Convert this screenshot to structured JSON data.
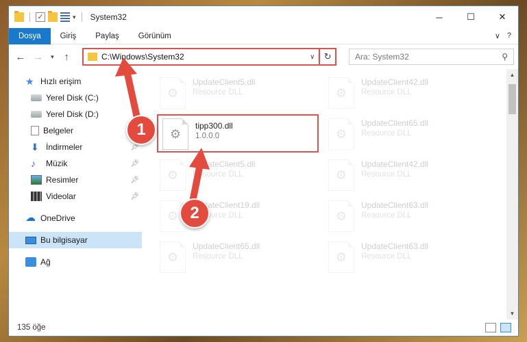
{
  "window": {
    "title": "System32",
    "controls": {
      "minimize": "─",
      "maximize": "☐",
      "close": "✕"
    }
  },
  "ribbon": {
    "tabs": [
      {
        "label": "Dosya",
        "active": true
      },
      {
        "label": "Giriş"
      },
      {
        "label": "Paylaş"
      },
      {
        "label": "Görünüm"
      }
    ],
    "expand": "∨",
    "help": "?"
  },
  "address": {
    "path": "C:\\Windows\\System32",
    "search_placeholder": "Ara: System32"
  },
  "nav": {
    "items": [
      {
        "label": "Hızlı erişim",
        "icon": "star-icon"
      },
      {
        "label": "Yerel Disk (C:)",
        "icon": "drive-icon"
      },
      {
        "label": "Yerel Disk (D:)",
        "icon": "drive-icon"
      },
      {
        "label": "Belgeler",
        "icon": "document-icon"
      },
      {
        "label": "İndirmeler",
        "icon": "download-icon",
        "pinned": true
      },
      {
        "label": "Müzik",
        "icon": "music-icon",
        "pinned": true
      },
      {
        "label": "Resimler",
        "icon": "pictures-icon",
        "pinned": true
      },
      {
        "label": "Videolar",
        "icon": "video-icon",
        "pinned": true
      },
      {
        "label": "OneDrive",
        "icon": "cloud-icon"
      },
      {
        "label": "Bu bilgisayar",
        "icon": "computer-icon",
        "selected": true
      },
      {
        "label": "Ağ",
        "icon": "network-icon"
      }
    ]
  },
  "files": {
    "highlighted": {
      "name": "tipp300.dll",
      "desc": "1.0.0.0"
    },
    "faded": [
      {
        "name": "UpdateClient5.dll",
        "desc": "Resource DLL"
      },
      {
        "name": "UpdateClient42.dll",
        "desc": "Resource DLL"
      },
      {
        "name": "UpdateClient65.dll",
        "desc": "Resource DLL"
      },
      {
        "name": "UpdateClient5.dll",
        "desc": "Resource DLL"
      },
      {
        "name": "UpdateClient42.dll",
        "desc": "Resource DLL"
      },
      {
        "name": "UpdateClient19.dll",
        "desc": "Resource DLL"
      },
      {
        "name": "UpdateClient63.dll",
        "desc": "Resource DLL"
      },
      {
        "name": "UpdateClient65.dll",
        "desc": "Resource DLL"
      },
      {
        "name": "UpdateClient63.dll",
        "desc": "Resource DLL"
      }
    ]
  },
  "status": {
    "count": "135 öğe"
  },
  "annotations": {
    "step1": "1",
    "step2": "2",
    "color": "#e24b3e"
  }
}
